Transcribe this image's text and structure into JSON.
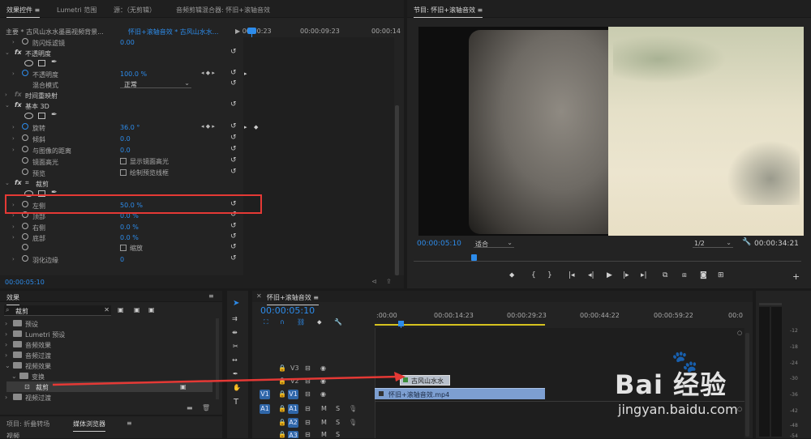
{
  "effect_controls": {
    "tabs": [
      "效果控件 ≡",
      "Lumetri 范围",
      "源：（无剪辑）",
      "音频剪辑混合器: 怀旧+滚轴音效"
    ],
    "master_clip": "主要 * 古风山水水墨画视频背景...",
    "seq_clip": "怀旧+滚轴音效 * 古风山水水...",
    "ruler": [
      "00:00",
      "00:00:09:23",
      "00:00:14"
    ],
    "ruler_first": "▶ 00:00:23",
    "rows": [
      {
        "name": "防闪烁滤镜",
        "value": "0.00"
      },
      {
        "name": "不透明度"
      },
      {
        "name": "不透明度",
        "value": "100.0 %"
      },
      {
        "name": "混合模式",
        "value": "正常"
      },
      {
        "name": "时间重映射"
      },
      {
        "name": "基本 3D"
      },
      {
        "name": "旋转",
        "value": "36.0 °"
      },
      {
        "name": "倾斜",
        "value": "0.0"
      },
      {
        "name": "与图像的距离",
        "value": "0.0"
      },
      {
        "name": "镜面高光",
        "value": "显示镜面高光"
      },
      {
        "name": "预览",
        "value": "绘制预览线框"
      },
      {
        "name": "裁剪"
      },
      {
        "name": "左侧",
        "value": "50.0 %"
      },
      {
        "name": "顶部",
        "value": "0.0 %"
      },
      {
        "name": "右侧",
        "value": "0.0 %"
      },
      {
        "name": "底部",
        "value": "0.0 %"
      },
      {
        "name": "",
        "value": "缩放"
      },
      {
        "name": "羽化边缘",
        "value": "0"
      }
    ],
    "current_time": "00:00:05:10"
  },
  "program_monitor": {
    "title": "节目: 怀旧+滚轴音效 ≡",
    "timecode": "00:00:05:10",
    "fit": "适合",
    "resolution": "1/2",
    "duration": "00:00:34:21"
  },
  "effects_panel": {
    "title": "效果",
    "search_value": "裁剪",
    "tree": [
      {
        "label": "预设",
        "indent": 0
      },
      {
        "label": "Lumetri 预设",
        "indent": 0
      },
      {
        "label": "音频效果",
        "indent": 0
      },
      {
        "label": "音频过渡",
        "indent": 0
      },
      {
        "label": "视频效果",
        "indent": 0
      },
      {
        "label": "变换",
        "indent": 1
      },
      {
        "label": "裁剪",
        "indent": 2
      },
      {
        "label": "视频过渡",
        "indent": 0
      }
    ],
    "bottom_tabs": [
      "项目: 折叠转场",
      "媒体浏览器",
      "≡"
    ],
    "bottom_item": "视频"
  },
  "timeline": {
    "title": "怀旧+滚轴音效 ≡",
    "timecode": "00:00:05:10",
    "ruler": [
      ":00:00",
      "00:00:14:23",
      "00:00:29:23",
      "00:00:44:22",
      "00:00:59:22",
      "00:0"
    ],
    "tracks": [
      {
        "name": "V3",
        "src": ""
      },
      {
        "name": "V2",
        "src": ""
      },
      {
        "name": "V1",
        "src": "V1"
      },
      {
        "name": "A1",
        "src": "A1"
      },
      {
        "name": "A2",
        "src": ""
      },
      {
        "name": "A3",
        "src": ""
      }
    ],
    "clips": {
      "v2": "古风山水水",
      "v1": "怀旧+滚轴音效.mp4"
    }
  },
  "audio_meter": {
    "labels": [
      "-12",
      "-18",
      "-24",
      "-30",
      "-36",
      "-42",
      "-48",
      "-54"
    ]
  },
  "watermark": {
    "text": "Bai 经验",
    "url": "jingyan.baidu.com"
  }
}
